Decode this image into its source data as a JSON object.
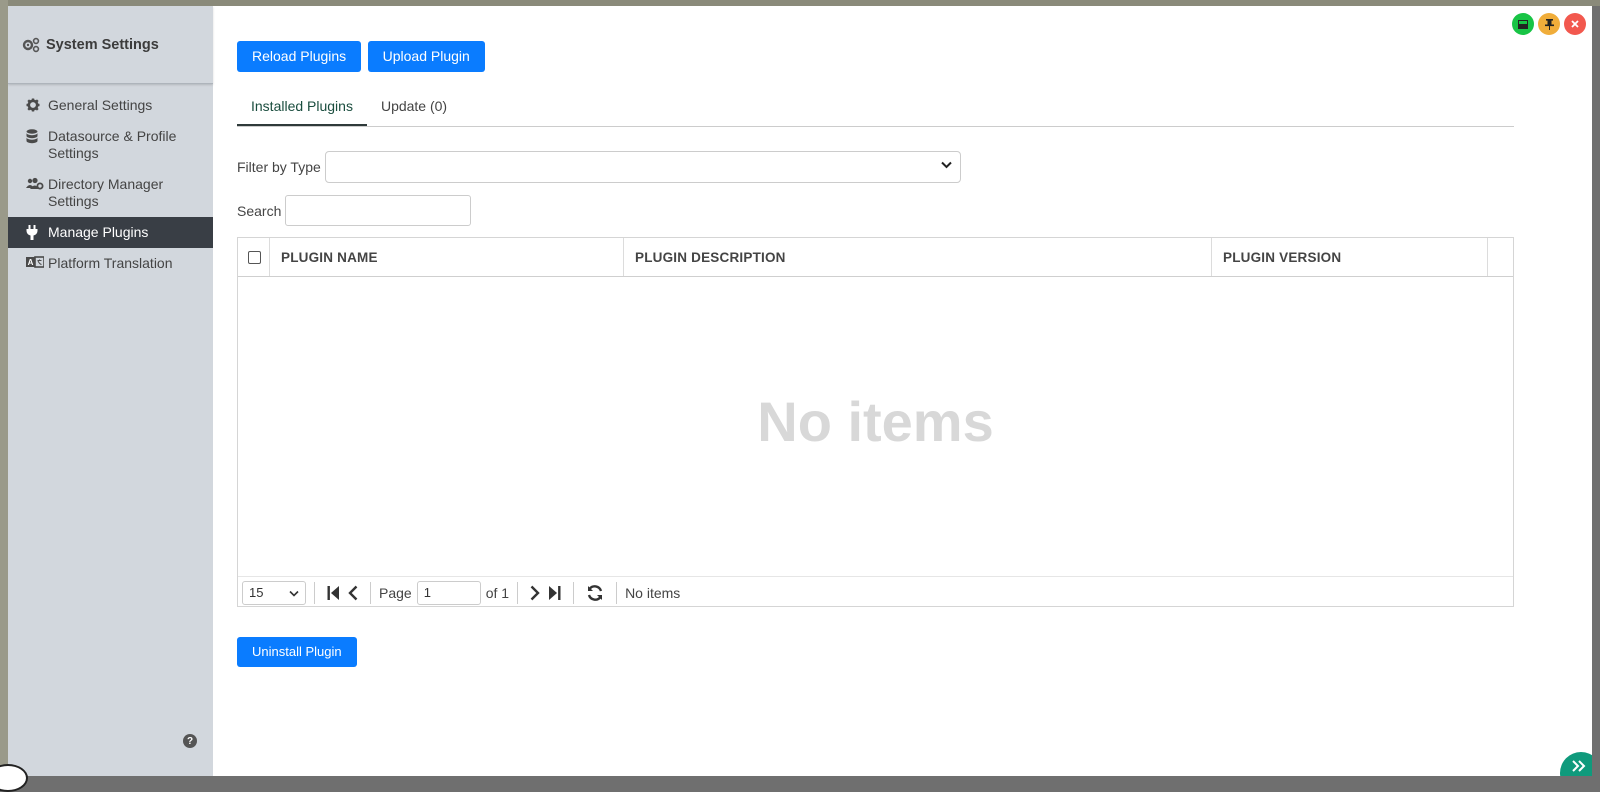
{
  "sidebar": {
    "title": "System Settings",
    "items": [
      {
        "label": "General Settings"
      },
      {
        "label": "Datasource & Profile Settings"
      },
      {
        "label": "Directory Manager Settings"
      },
      {
        "label": "Manage Plugins"
      },
      {
        "label": "Platform Translation"
      }
    ],
    "active_index": 3,
    "help_glyph": "?"
  },
  "toolbar": {
    "reload_label": "Reload Plugins",
    "upload_label": "Upload Plugin"
  },
  "tabs": [
    {
      "label": "Installed Plugins"
    },
    {
      "label": "Update (0)"
    }
  ],
  "filter": {
    "label": "Filter by Type",
    "value": ""
  },
  "search": {
    "label": "Search",
    "value": ""
  },
  "grid": {
    "columns": [
      "PLUGIN NAME",
      "PLUGIN DESCRIPTION",
      "PLUGIN VERSION"
    ],
    "rows": [],
    "empty_text": "No items"
  },
  "pager": {
    "page_size": "15",
    "page_label": "Page",
    "page_value": "1",
    "of_label": "of 1",
    "status": "No items"
  },
  "actions": {
    "uninstall_label": "Uninstall Plugin"
  },
  "window": {
    "controls": [
      "minimize-icon",
      "pin-icon",
      "close-icon"
    ],
    "colors": {
      "green": "#18c445",
      "orange": "#f0ad3a",
      "red": "#f2584e",
      "accent": "#0a7cff"
    }
  }
}
